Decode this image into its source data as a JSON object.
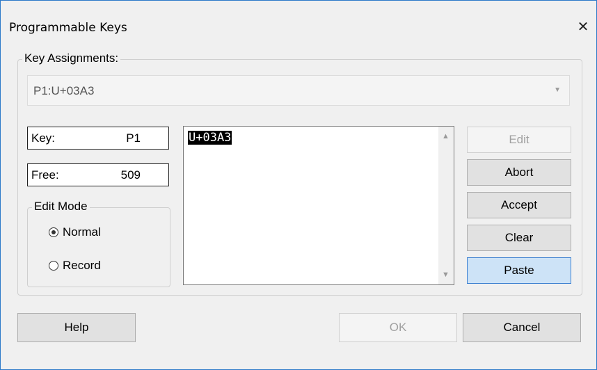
{
  "window": {
    "title": "Programmable Keys"
  },
  "key_assignments": {
    "legend": "Key Assignments:",
    "selected": "P1:U+03A3"
  },
  "key": {
    "label": "Key:",
    "value": "P1"
  },
  "free": {
    "label": "Free:",
    "value": "509"
  },
  "edit_mode": {
    "legend": "Edit Mode",
    "options": [
      {
        "label": "Normal",
        "selected": true
      },
      {
        "label": "Record",
        "selected": false
      }
    ]
  },
  "editor": {
    "content": "U+03A3"
  },
  "side_buttons": {
    "edit": "Edit",
    "abort": "Abort",
    "accept": "Accept",
    "clear": "Clear",
    "paste": "Paste"
  },
  "bottom_buttons": {
    "help": "Help",
    "ok": "OK",
    "cancel": "Cancel"
  }
}
